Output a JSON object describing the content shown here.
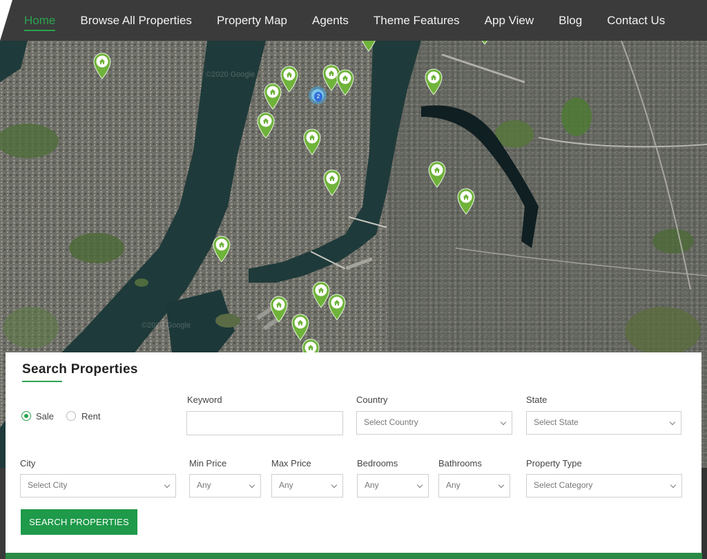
{
  "nav": {
    "items": [
      {
        "label": "Home",
        "active": true
      },
      {
        "label": "Browse All Properties",
        "active": false
      },
      {
        "label": "Property Map",
        "active": false
      },
      {
        "label": "Agents",
        "active": false
      },
      {
        "label": "Theme Features",
        "active": false
      },
      {
        "label": "App View",
        "active": false
      },
      {
        "label": "Blog",
        "active": false
      },
      {
        "label": "Contact Us",
        "active": false
      }
    ]
  },
  "map": {
    "watermark_1": "©2020 Google",
    "watermark_2": "©2020 Google",
    "cluster_count": "2",
    "marker_icon": "house-pin-icon",
    "marker_color": "#6fb33a"
  },
  "search": {
    "title": "Search Properties",
    "radio_sale": "Sale",
    "radio_rent": "Rent",
    "keyword": {
      "label": "Keyword",
      "value": "",
      "placeholder": ""
    },
    "country": {
      "label": "Country",
      "value": "Select Country"
    },
    "state": {
      "label": "State",
      "value": "Select State"
    },
    "city": {
      "label": "City",
      "value": "Select City"
    },
    "min_price": {
      "label": "Min Price",
      "value": "Any"
    },
    "max_price": {
      "label": "Max Price",
      "value": "Any"
    },
    "bedrooms": {
      "label": "Bedrooms",
      "value": "Any"
    },
    "bathrooms": {
      "label": "Bathrooms",
      "value": "Any"
    },
    "property_type": {
      "label": "Property Type",
      "value": "Select Category"
    },
    "button": "SEARCH PROPERTIES",
    "accent": "#2aa44f"
  }
}
